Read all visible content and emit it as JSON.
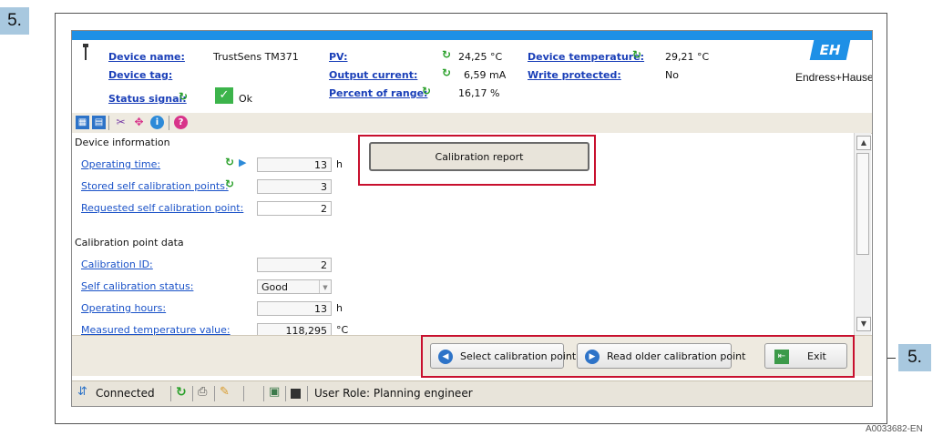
{
  "step_labels": {
    "left": "5.",
    "right": "5."
  },
  "figure_id": "A0033682-EN",
  "header": {
    "device_name_label": "Device name:",
    "device_name_value": "TrustSens TM371",
    "device_tag_label": "Device tag:",
    "status_signal_label": "Status signal:",
    "status_signal_value": "Ok",
    "pv_label": "PV:",
    "pv_value": "24,25 °C",
    "output_current_label": "Output current:",
    "output_current_value": "6,59 mA",
    "percent_range_label": "Percent of range:",
    "percent_range_value": "16,17 %",
    "device_temp_label": "Device temperature:",
    "device_temp_value": "29,21 °C",
    "write_protected_label": "Write protected:",
    "write_protected_value": "No",
    "brand": "Endress+Hauser",
    "brand_logo_letters": "EH"
  },
  "toolbar_icons": [
    "table-view-icon",
    "table-edit-icon",
    "tools-icon",
    "move-icon",
    "info-icon",
    "help-icon"
  ],
  "panel": {
    "device_info_title": "Device information",
    "operating_time_label": "Operating time:",
    "operating_time_value": "13",
    "operating_time_unit": "h",
    "stored_points_label": "Stored self calibration points:",
    "stored_points_value": "3",
    "requested_point_label": "Requested self calibration point:",
    "requested_point_value": "2",
    "calibration_report_button": "Calibration report",
    "cal_point_title": "Calibration point data",
    "calibration_id_label": "Calibration ID:",
    "calibration_id_value": "2",
    "self_cal_status_label": "Self calibration status:",
    "self_cal_status_value": "Good",
    "operating_hours_label": "Operating hours:",
    "operating_hours_value": "13",
    "operating_hours_unit": "h",
    "measured_temp_label": "Measured temperature value:",
    "measured_temp_value": "118,295",
    "measured_temp_unit": "°C"
  },
  "bottom_buttons": {
    "select_point": "Select calibration point",
    "read_older": "Read older calibration point",
    "exit": "Exit"
  },
  "status_bar": {
    "connection": "Connected",
    "user_role": "User Role: Planning engineer"
  },
  "colors": {
    "accent_blue": "#1e90e6",
    "highlight_red": "#c8102e",
    "step_tag": "#a8c8df"
  }
}
